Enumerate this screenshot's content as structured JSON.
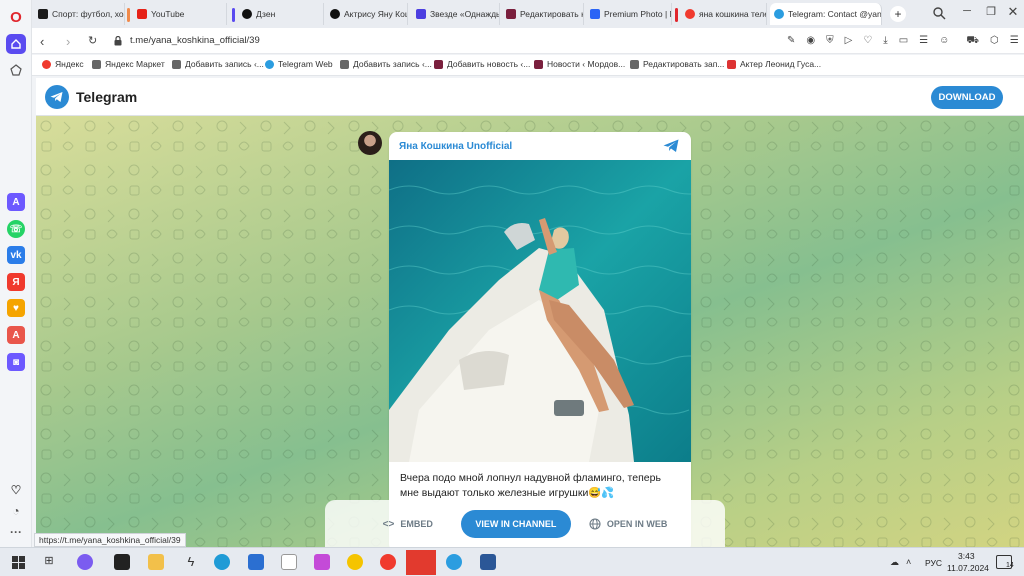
{
  "browser": {
    "tabs": [
      {
        "title": "Спорт: футбол, хо",
        "icon": "championat-icon",
        "color": "#1b1b1b"
      },
      {
        "title": "YouTube",
        "icon": "youtube-icon",
        "color": "#e62117"
      },
      {
        "title": "Дзен",
        "icon": "dzen-icon",
        "color": "#111111"
      },
      {
        "title": "Актрису Яну Кошк",
        "icon": "dzen-icon",
        "color": "#111111"
      },
      {
        "title": "Звезде «Однажды",
        "icon": "zvezda-icon",
        "color": "#4b3ee0"
      },
      {
        "title": "Редактировать но",
        "icon": "mordovia-icon",
        "color": "#7a1f3d"
      },
      {
        "title": "Premium Photo | M",
        "icon": "freepik-icon",
        "color": "#2a64f6"
      },
      {
        "title": "яна кошкина теле",
        "icon": "yandex-icon",
        "color": "#f03a2e"
      },
      {
        "title": "Telegram: Contact @yana",
        "icon": "telegram-icon",
        "color": "#2b9de0"
      }
    ],
    "url": "t.me/yana_koshkina_official/39",
    "status_url": "https://t.me/yana_koshkina_official/39",
    "bookmarks": [
      "Яндекс",
      "Яндекс Маркет",
      "Добавить запись ‹...",
      "Telegram Web",
      "Добавить запись ‹...",
      "Добавить новость ‹...",
      "Новости ‹ Мордов...",
      "Редактировать зап...",
      "Актер Леонид Гуса..."
    ]
  },
  "telegram": {
    "brand": "Telegram",
    "download": "DOWNLOAD",
    "channel_name": "Яна Кошкина Unofficial",
    "message_text": "Вчера подо мной лопнул надувной фламинго, теперь мне выдают только железные игрушки😅💦",
    "embed": "EMBED",
    "view_in_channel": "VIEW IN CHANNEL",
    "open_in_web": "OPEN IN WEB",
    "accent": "#2b8ad4"
  },
  "taskbar": {
    "lang": "РУС",
    "time": "3:43",
    "date": "11.07.2024",
    "notifications": "14"
  }
}
